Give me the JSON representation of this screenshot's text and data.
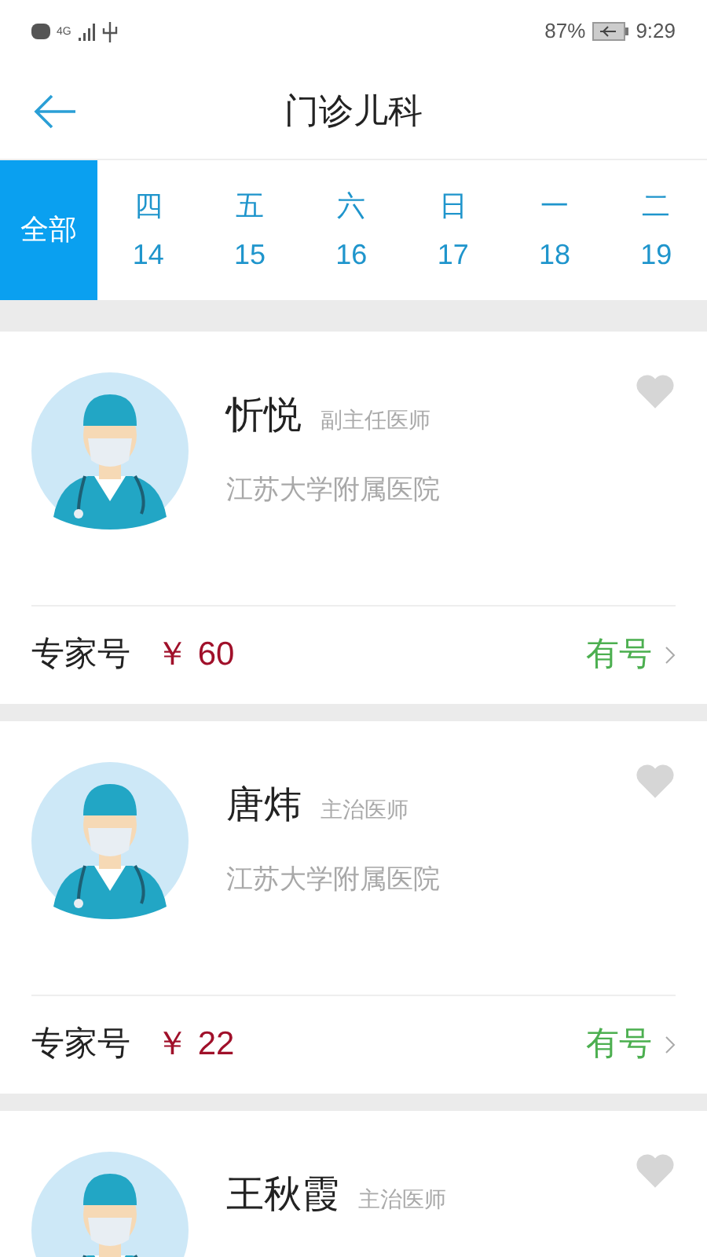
{
  "status_bar": {
    "network": "4G",
    "battery": "87%",
    "time": "9:29"
  },
  "header": {
    "title": "门诊儿科"
  },
  "dates": [
    {
      "weekday": "全部",
      "selected": true
    },
    {
      "weekday": "四",
      "day": "14",
      "selected": false
    },
    {
      "weekday": "五",
      "day": "15",
      "selected": false
    },
    {
      "weekday": "六",
      "day": "16",
      "selected": false
    },
    {
      "weekday": "日",
      "day": "17",
      "selected": false
    },
    {
      "weekday": "一",
      "day": "18",
      "selected": false
    },
    {
      "weekday": "二",
      "day": "19",
      "selected": false
    }
  ],
  "doctors": [
    {
      "name": "忻悦",
      "title": "副主任医师",
      "hospital": "江苏大学附属医院",
      "favorite": false,
      "type": "专家号",
      "price": "￥ 60",
      "availability": "有号",
      "available": true
    },
    {
      "name": "唐炜",
      "title": "主治医师",
      "hospital": "江苏大学附属医院",
      "favorite": false,
      "type": "专家号",
      "price": "￥ 22",
      "availability": "有号",
      "available": true
    },
    {
      "name": "王秋霞",
      "title": "主治医师",
      "favorite": false
    }
  ]
}
